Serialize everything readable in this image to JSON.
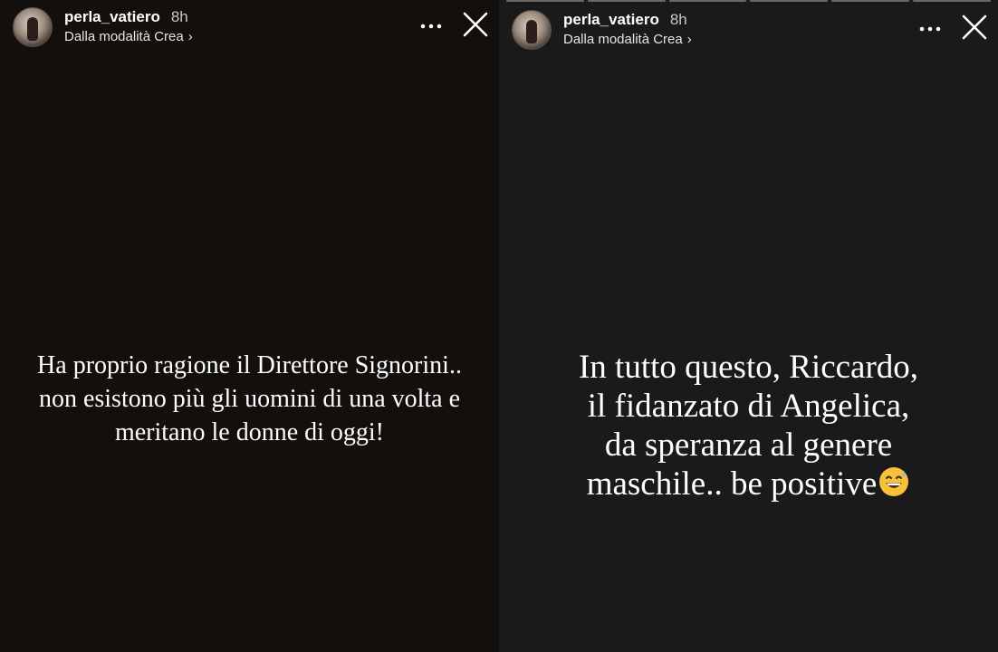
{
  "stories": [
    {
      "username": "perla_vatiero",
      "time": "8h",
      "subtitle": "Dalla modalità Crea",
      "chevron": "›",
      "text_lines": [
        "Ha proprio ragione il Direttore Signorini..",
        "non esistono più gli uomini di una volta e",
        "meritano le donne di oggi!"
      ]
    },
    {
      "username": "perla_vatiero",
      "time": "8h",
      "subtitle": "Dalla modalità Crea",
      "chevron": "›",
      "text_lines": [
        "In tutto questo, Riccardo,",
        "il fidanzato di Angelica,",
        "da speranza al genere",
        "maschile.. be positive"
      ],
      "emoji": "grinning-face-with-sweat-emoji"
    }
  ],
  "icons": {
    "more": "more-horizontal-icon",
    "close": "close-icon"
  },
  "colors": {
    "left_background": "#120f0d",
    "right_background": "#1a1a1a",
    "text": "#ffffff"
  }
}
